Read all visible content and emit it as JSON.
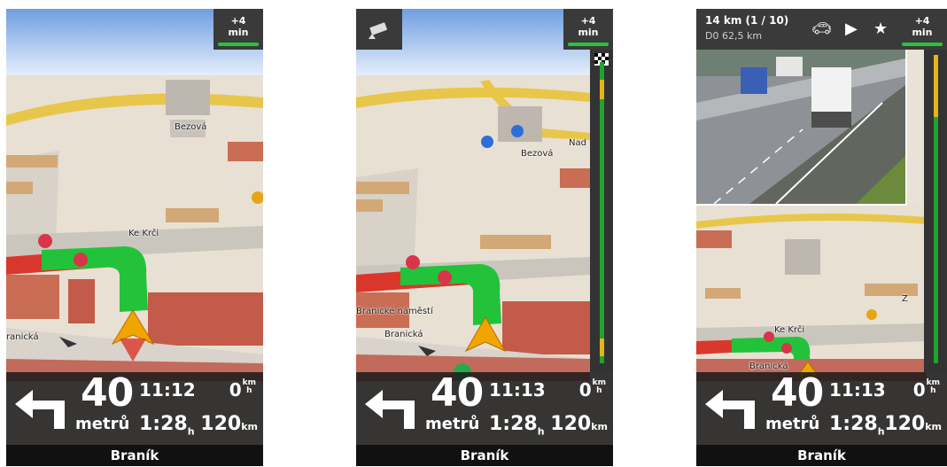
{
  "screens": [
    {
      "delay": {
        "value": "+4",
        "unit": "min"
      },
      "nav": {
        "distance": "40",
        "distance_unit": "metrů",
        "time": "11:12",
        "duration": "1:28",
        "duration_unit": "h",
        "speed": "0",
        "speed_unit_top": "km",
        "speed_unit_bottom": "h",
        "remaining": "120",
        "remaining_unit": "km",
        "street": "Braník"
      },
      "labels": {
        "a": "Bezová",
        "b": "Ke Krči",
        "c": "ranická"
      }
    },
    {
      "delay": {
        "value": "+4",
        "unit": "min"
      },
      "nav": {
        "distance": "40",
        "distance_unit": "metrů",
        "time": "11:13",
        "duration": "1:28",
        "duration_unit": "h",
        "speed": "0",
        "speed_unit_top": "km",
        "speed_unit_bottom": "h",
        "remaining": "120",
        "remaining_unit": "km",
        "street": "Braník"
      },
      "labels": {
        "a": "Bezová",
        "b": "Nad",
        "c": "Branické náměstí",
        "d": "Branická"
      }
    },
    {
      "delay": {
        "value": "+4",
        "unit": "min"
      },
      "topbar": {
        "title": "14 km (1 / 10)",
        "subtitle": "D0 62,5 km"
      },
      "nav": {
        "distance": "40",
        "distance_unit": "metrů",
        "time": "11:13",
        "duration": "1:28",
        "duration_unit": "h",
        "speed": "0",
        "speed_unit_top": "km",
        "speed_unit_bottom": "h",
        "remaining": "120",
        "remaining_unit": "km",
        "street": "Braník"
      },
      "labels": {
        "b": "Ke Krči",
        "d": "Branická",
        "e": "Z"
      }
    }
  ],
  "colors": {
    "route": "#22c33a",
    "traffic": "#d9372b",
    "bar_bg": "#1c1c1c",
    "accent": "#27c43a",
    "arrow": "#f0a500"
  },
  "icons": [
    "turn-left-icon",
    "speed-camera-icon",
    "car-icon",
    "play-icon",
    "star-icon",
    "position-arrow-icon",
    "finish-flag-icon"
  ]
}
